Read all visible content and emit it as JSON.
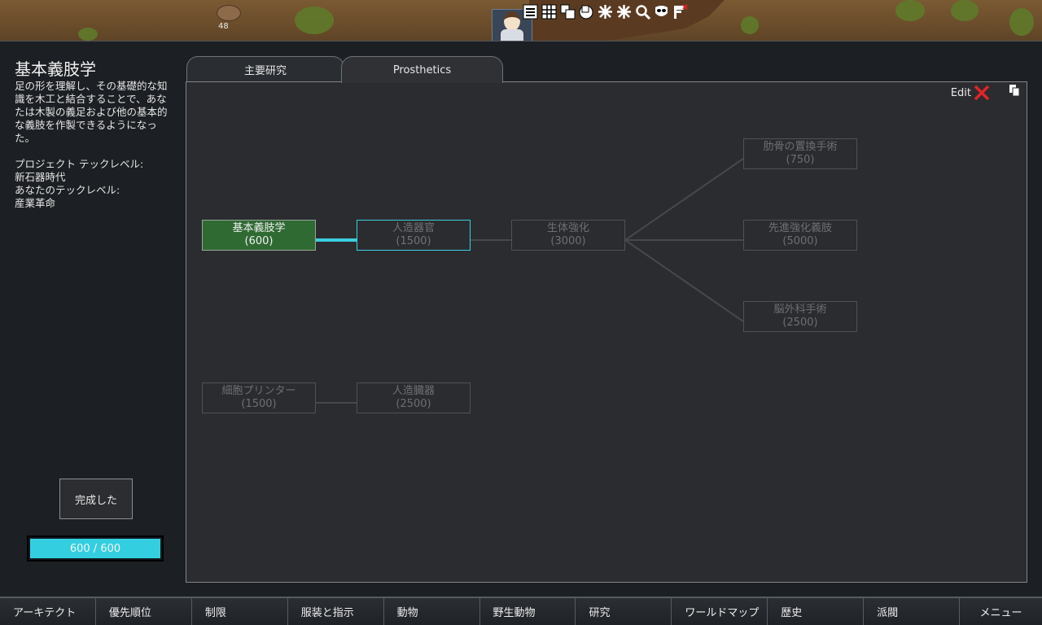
{
  "world": {
    "rock_count": "48",
    "toolbar_icons": [
      "work-list-icon",
      "schedule-icon",
      "assign-icon",
      "areas-icon",
      "restrict-icon",
      "zone-icon",
      "search-icon",
      "faction-icon",
      "flag-icon"
    ]
  },
  "research": {
    "title": "基本義肢学",
    "description": "足の形を理解し、その基礎的な知識を木工と結合することで、あなたは木製の義足および他の基本的な義肢を作製できるようになった。",
    "project_tech_label": "プロジェクト テックレベル:",
    "project_tech_value": "新石器時代",
    "your_tech_label": "あなたのテックレベル:",
    "your_tech_value": "産業革命",
    "done_button": "完成した",
    "progress": {
      "current": 600,
      "total": 600,
      "text": "600 / 600"
    }
  },
  "tabs": [
    {
      "label": "主要研究",
      "active": false
    },
    {
      "label": "Prosthetics",
      "active": true
    }
  ],
  "tree_toolbar": {
    "edit_label": "Edit"
  },
  "nodes": [
    {
      "name": "基本義肢学",
      "cost": "(600)",
      "state": "done"
    },
    {
      "name": "人造器官",
      "cost": "(1500)",
      "state": "available"
    },
    {
      "name": "生体強化",
      "cost": "(3000)",
      "state": "locked"
    },
    {
      "name": "肋骨の置換手術",
      "cost": "(750)",
      "state": "locked"
    },
    {
      "name": "先進強化義肢",
      "cost": "(5000)",
      "state": "locked"
    },
    {
      "name": "脳外科手術",
      "cost": "(2500)",
      "state": "locked"
    },
    {
      "name": "細胞プリンター",
      "cost": "(1500)",
      "state": "locked"
    },
    {
      "name": "人造臓器",
      "cost": "(2500)",
      "state": "locked"
    }
  ],
  "bottom_bar": [
    "アーキテクト",
    "優先順位",
    "制限",
    "服装と指示",
    "動物",
    "野生動物",
    "研究",
    "ワールドマップ",
    "歴史",
    "派閥",
    "メニュー"
  ],
  "colors": {
    "done_node": "#2f6a33",
    "available_border": "#3ccde0",
    "progress_fill": "#33cfe0",
    "close_red": "#e0242a"
  }
}
